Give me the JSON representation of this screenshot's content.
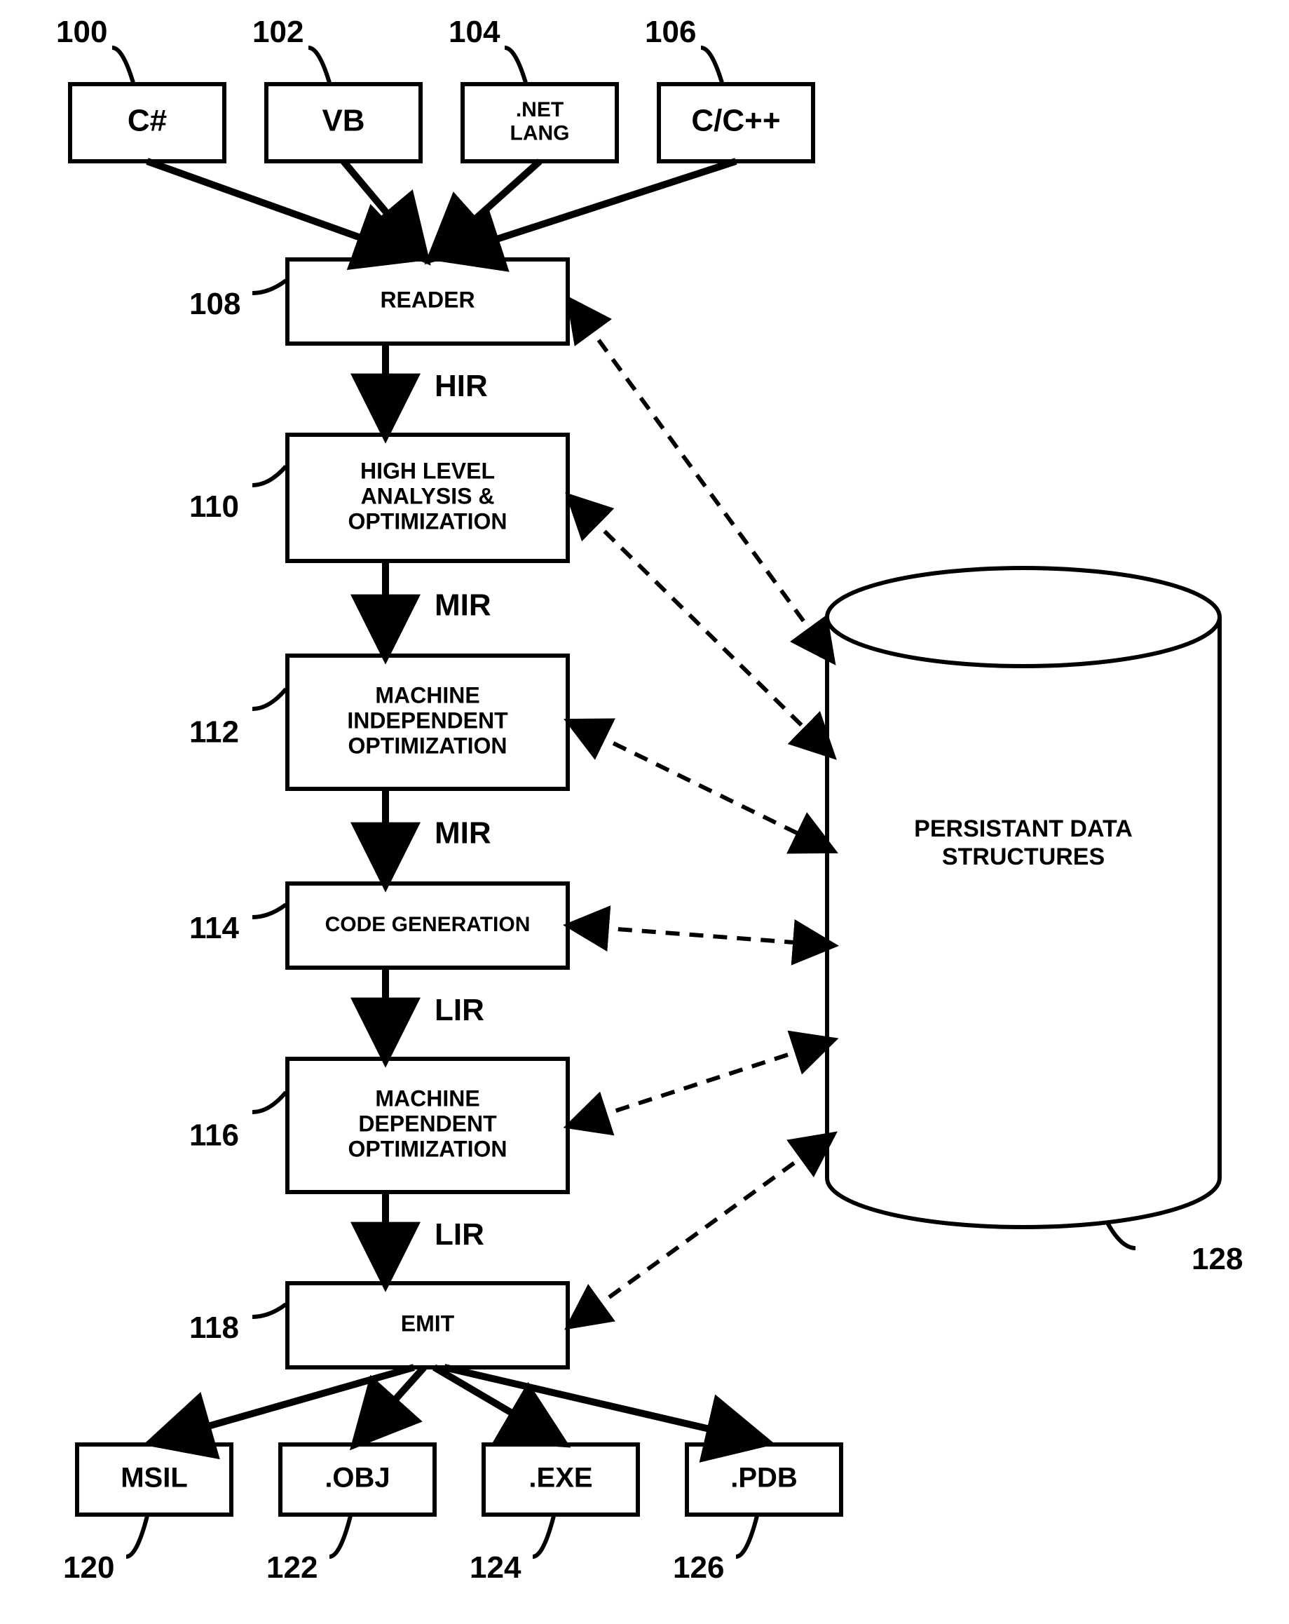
{
  "inputs": [
    {
      "num": "100",
      "label": "C#"
    },
    {
      "num": "102",
      "label": "VB"
    },
    {
      "num": "104",
      "label": ".NET LANG"
    },
    {
      "num": "106",
      "label": "C/C++"
    }
  ],
  "stages": [
    {
      "num": "108",
      "label": "READER",
      "out_edge": "HIR"
    },
    {
      "num": "110",
      "label": "HIGH LEVEL ANALYSIS & OPTIMIZATION",
      "out_edge": "MIR"
    },
    {
      "num": "112",
      "label": "MACHINE INDEPENDENT OPTIMIZATION",
      "out_edge": "MIR"
    },
    {
      "num": "114",
      "label": "CODE GENERATION",
      "out_edge": "LIR"
    },
    {
      "num": "116",
      "label": "MACHINE DEPENDENT OPTIMIZATION",
      "out_edge": "LIR"
    },
    {
      "num": "118",
      "label": "EMIT",
      "out_edge": ""
    }
  ],
  "outputs": [
    {
      "num": "120",
      "label": "MSIL"
    },
    {
      "num": "122",
      "label": ".OBJ"
    },
    {
      "num": "124",
      "label": ".EXE"
    },
    {
      "num": "126",
      "label": ".PDB"
    }
  ],
  "datastore": {
    "num": "128",
    "label": "PERSISTANT DATA STRUCTURES"
  }
}
